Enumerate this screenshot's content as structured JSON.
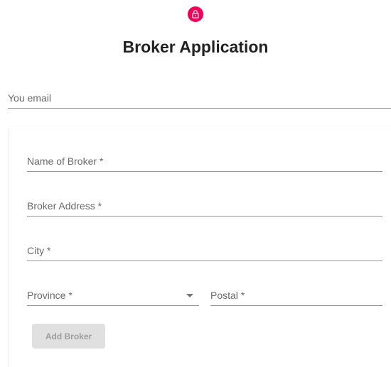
{
  "header": {
    "title": "Broker Application",
    "icon": "lock-icon",
    "icon_color": "#f50057"
  },
  "email_field": {
    "label": "You email"
  },
  "broker_form": {
    "name_label": "Name of Broker *",
    "address_label": "Broker Address *",
    "city_label": "City *",
    "province_label": "Province *",
    "postal_label": "Postal *",
    "add_button_label": "Add Broker"
  }
}
